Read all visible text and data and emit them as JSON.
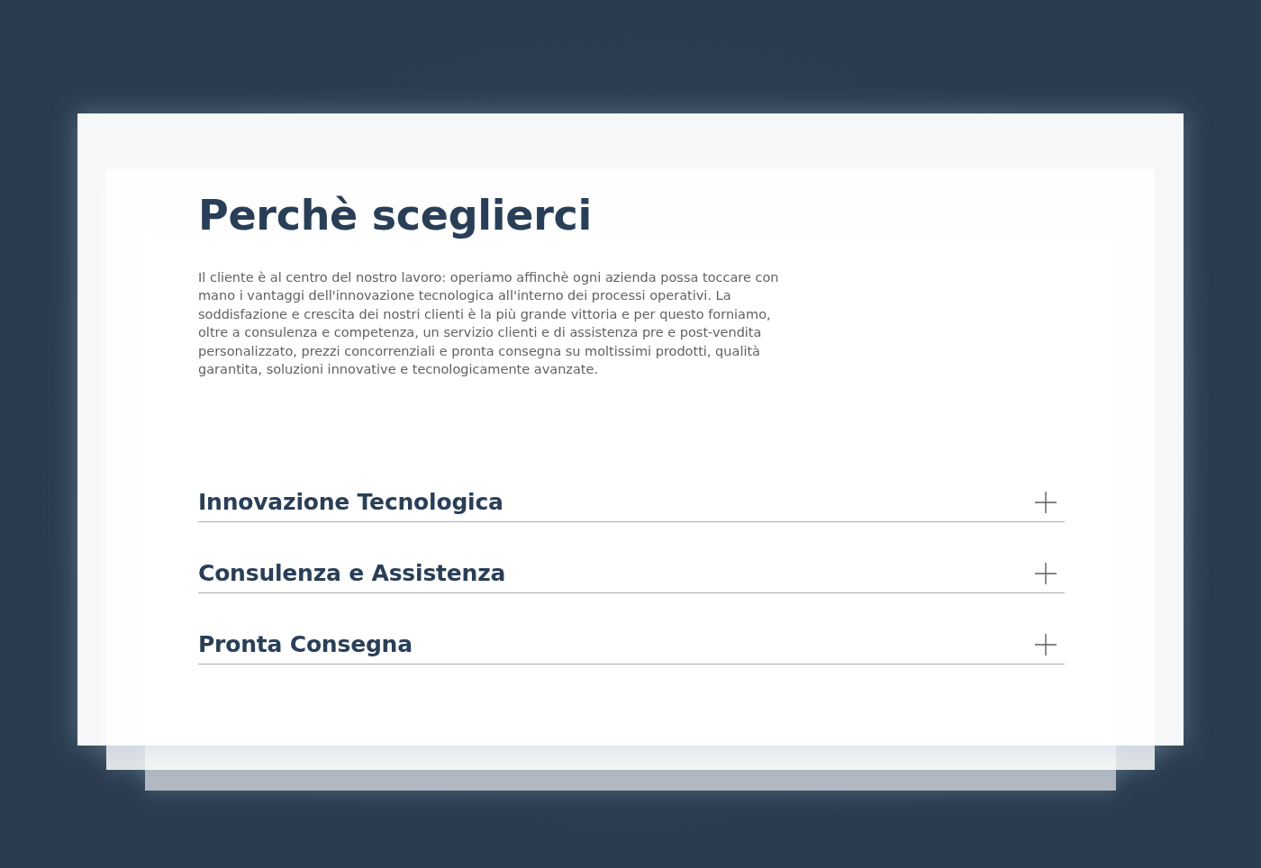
{
  "section": {
    "title": "Perchè sceglierci",
    "description": "Il cliente è al centro del nostro lavoro: operiamo affinchè ogni azienda possa toccare con mano i vantaggi dell'innovazione tecnologica all'interno dei processi operativi. La soddisfazione e crescita dei nostri clienti è la più grande vittoria e per questo forniamo, oltre a consulenza e competenza, un servizio clienti e di assistenza pre e post-vendita personalizzato, prezzi concorrenziali e pronta consegna su moltissimi prodotti, qualità garantita, soluzioni innovative e tecnologicamente avanzate."
  },
  "accordion": [
    {
      "title": "Innovazione Tecnologica",
      "expanded": false
    },
    {
      "title": "Consulenza e Assistenza",
      "expanded": false
    },
    {
      "title": "Pronta Consegna",
      "expanded": false
    }
  ]
}
